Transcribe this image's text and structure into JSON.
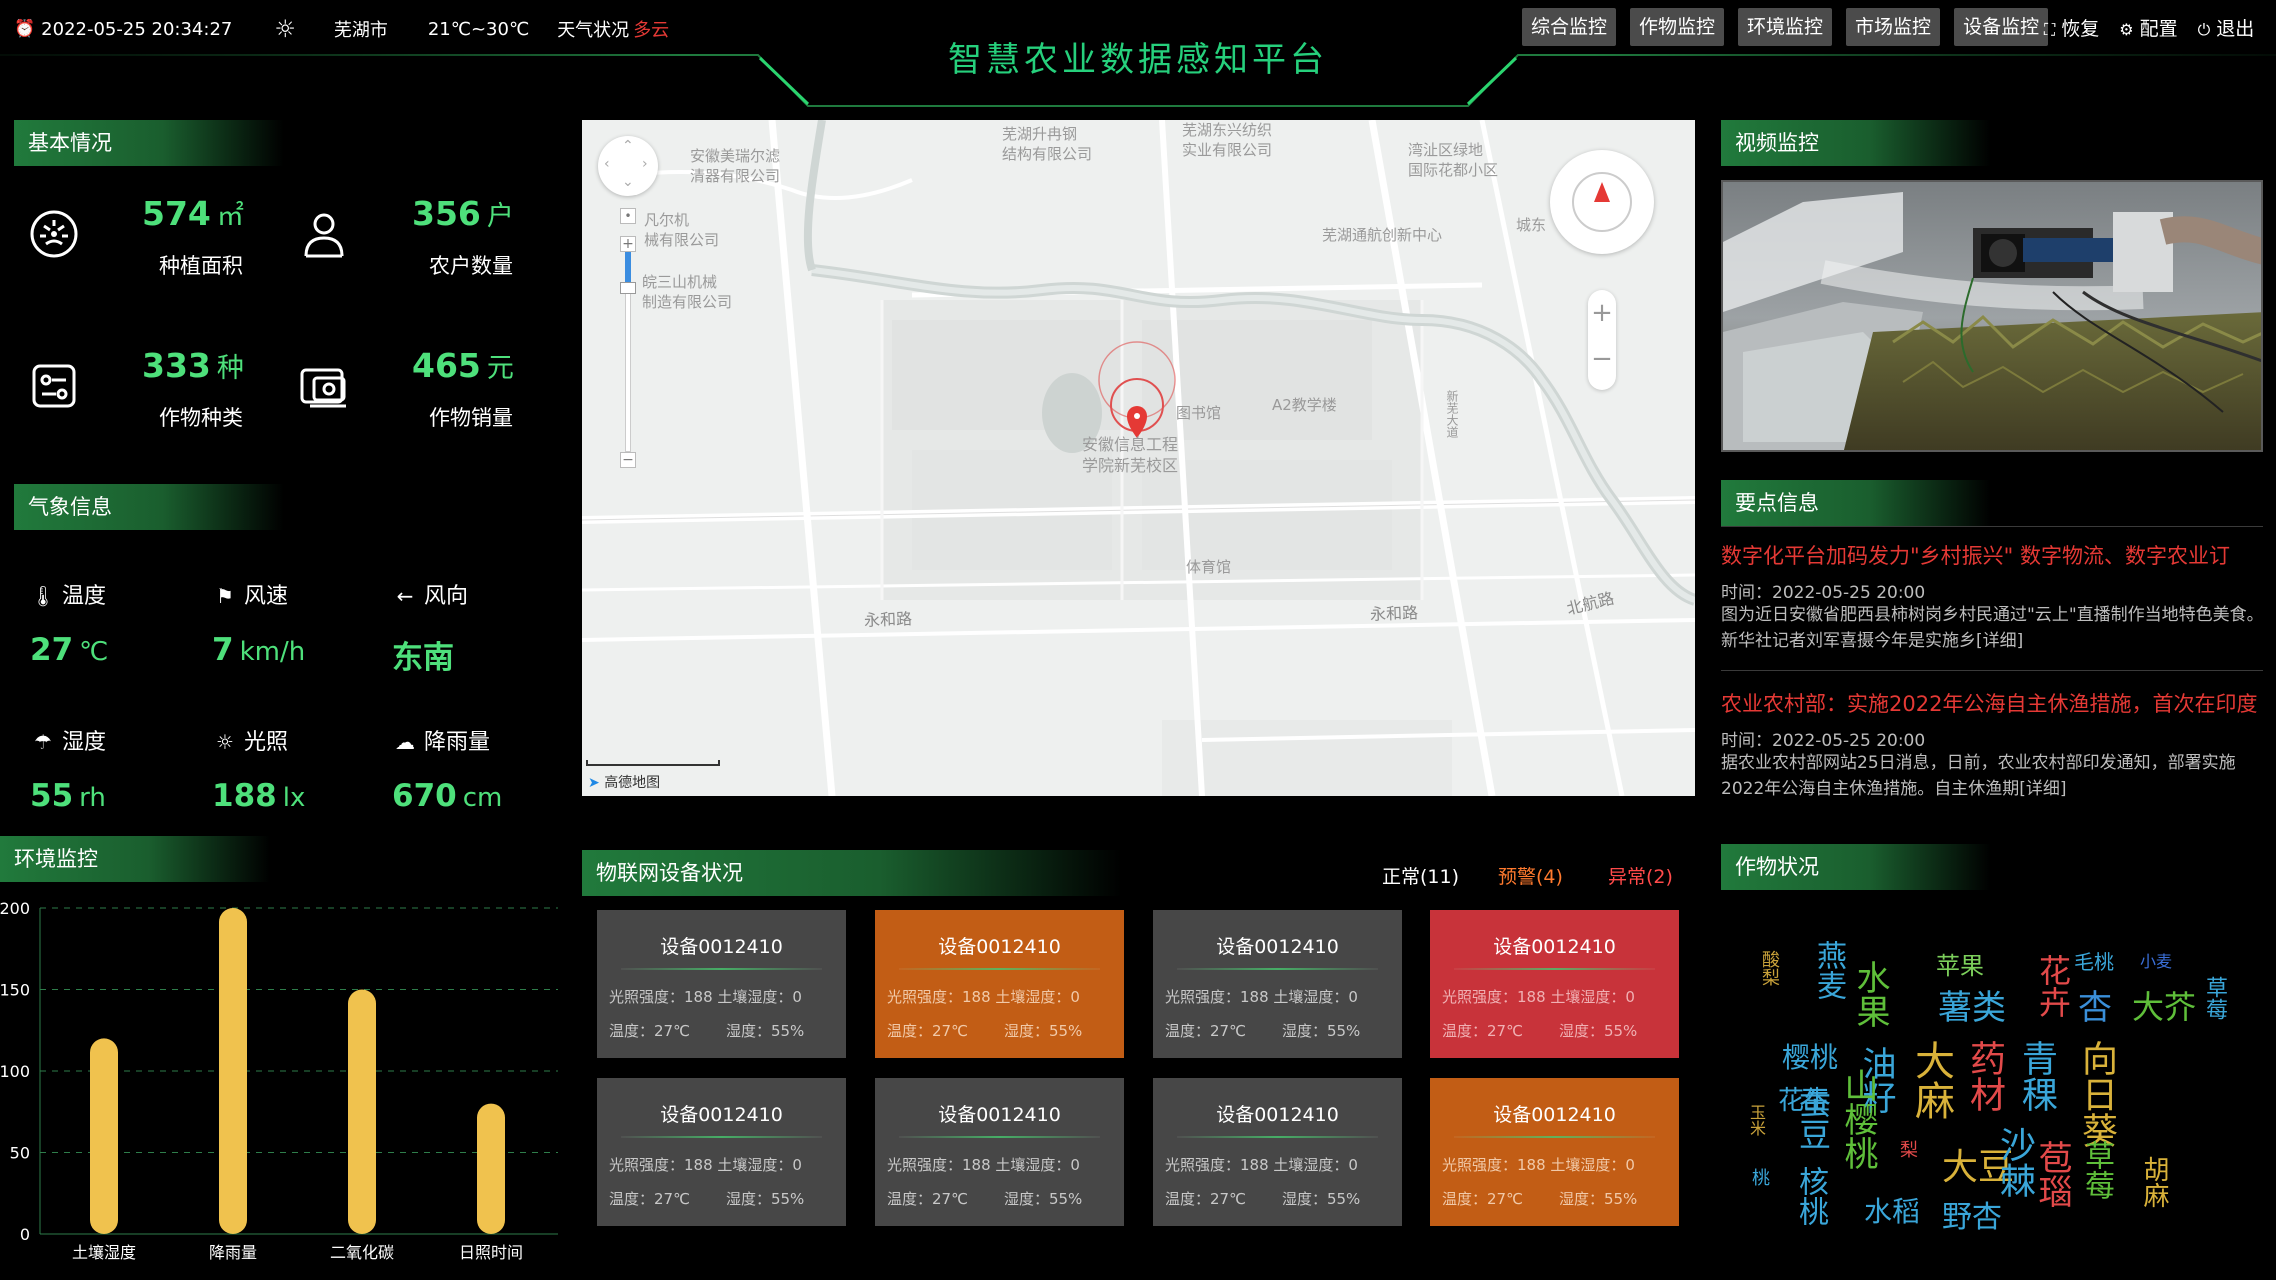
{
  "header": {
    "datetime": "2022-05-25 20:34:27",
    "city": "芜湖市",
    "temperature_range": "21℃~30℃",
    "weather_label": "天气状况",
    "weather_value": "多云",
    "title": "智慧农业数据感知平台",
    "nav": [
      "综合监控",
      "作物监控",
      "环境监控",
      "市场监控",
      "设备监控"
    ],
    "tools": [
      {
        "icon": "expand-icon",
        "label": "恢复"
      },
      {
        "icon": "gear-icon",
        "label": "配置"
      },
      {
        "icon": "power-icon",
        "label": "退出"
      }
    ]
  },
  "basic": {
    "title": "基本情况",
    "items": [
      {
        "icon": "dial-icon",
        "value": "574",
        "unit": "㎡",
        "label": "种植面积"
      },
      {
        "icon": "user-icon",
        "value": "356",
        "unit": "户",
        "label": "农户数量"
      },
      {
        "icon": "settings-panel-icon",
        "value": "333",
        "unit": "种",
        "label": "作物种类"
      },
      {
        "icon": "sales-icon",
        "value": "465",
        "unit": "元",
        "label": "作物销量"
      }
    ]
  },
  "weather": {
    "title": "气象信息",
    "items": [
      {
        "icon": "thermometer-icon",
        "label": "温度",
        "value": "27",
        "unit": "℃"
      },
      {
        "icon": "flag-icon",
        "label": "风速",
        "value": "7",
        "unit": "km/h"
      },
      {
        "icon": "arrow-left-icon",
        "label": "风向",
        "value": "东南",
        "unit": ""
      },
      {
        "icon": "umbrella-icon",
        "label": "湿度",
        "value": "55",
        "unit": "rh"
      },
      {
        "icon": "sun-icon",
        "label": "光照",
        "value": "188",
        "unit": "lx"
      },
      {
        "icon": "cloud-icon",
        "label": "降雨量",
        "value": "670",
        "unit": "cm"
      }
    ]
  },
  "env": {
    "title": "环境监控"
  },
  "chart_data": {
    "type": "bar",
    "categories": [
      "土壤湿度",
      "降雨量",
      "二氧化碳",
      "日照时间"
    ],
    "values": [
      120,
      200,
      150,
      80
    ],
    "ylim": [
      0,
      200
    ],
    "yticks": [
      0,
      50,
      100,
      150,
      200
    ],
    "grid": true,
    "bar_color": "#f0c24e"
  },
  "map": {
    "labels": [
      {
        "text": "安徽美瑞尔滤"
      },
      {
        "text": "清器有限公司"
      },
      {
        "text": "芜湖升冉钢"
      },
      {
        "text": "结构有限公司"
      },
      {
        "text": "芜湖东兴纺织"
      },
      {
        "text": "实业有限公司"
      },
      {
        "text": "湾沚区绿地"
      },
      {
        "text": "国际花都小区"
      },
      {
        "text": "凡尔机"
      },
      {
        "text": "械有限公司"
      },
      {
        "text": "芜湖通航创新中心"
      },
      {
        "text": "城东"
      },
      {
        "text": "皖三山机械"
      },
      {
        "text": "制造有限公司"
      },
      {
        "text": "图书馆"
      },
      {
        "text": "A2教学楼"
      },
      {
        "text": "安徽信息工程"
      },
      {
        "text": "学院新芜校区"
      },
      {
        "text": "体育馆"
      },
      {
        "text": "永和路"
      },
      {
        "text": "永和路"
      },
      {
        "text": "北航路"
      },
      {
        "text": "新芜大道"
      }
    ],
    "attribution": "高德地图"
  },
  "devices": {
    "title": "物联网设备状况",
    "status": {
      "normal": "正常(11)",
      "warn": "预警(4)",
      "error": "异常(2)"
    },
    "colors": {
      "normal": "#474747",
      "warn": "#c25d15",
      "error": "#c8333a",
      "warn_text": "#ff7a2e",
      "error_text": "#ff4a4a"
    },
    "list": [
      {
        "name": "设备0012410",
        "state": "normal",
        "line1": "光照强度：188 土壤湿度：0",
        "temp": "温度：27℃",
        "humidity": "湿度：55%"
      },
      {
        "name": "设备0012410",
        "state": "warn",
        "line1": "光照强度：188 土壤湿度：0",
        "temp": "温度：27℃",
        "humidity": "湿度：55%"
      },
      {
        "name": "设备0012410",
        "state": "normal",
        "line1": "光照强度：188 土壤湿度：0",
        "temp": "温度：27℃",
        "humidity": "湿度：55%"
      },
      {
        "name": "设备0012410",
        "state": "error",
        "line1": "光照强度：188 土壤湿度：0",
        "temp": "温度：27℃",
        "humidity": "湿度：55%"
      },
      {
        "name": "设备0012410",
        "state": "normal",
        "line1": "光照强度：188 土壤湿度：0",
        "temp": "温度：27℃",
        "humidity": "湿度：55%"
      },
      {
        "name": "设备0012410",
        "state": "normal",
        "line1": "光照强度：188 土壤湿度：0",
        "temp": "温度：27℃",
        "humidity": "湿度：55%"
      },
      {
        "name": "设备0012410",
        "state": "normal",
        "line1": "光照强度：188 土壤湿度：0",
        "temp": "温度：27℃",
        "humidity": "湿度：55%"
      },
      {
        "name": "设备0012410",
        "state": "warn",
        "line1": "光照强度：188 土壤湿度：0",
        "temp": "温度：27℃",
        "humidity": "湿度：55%"
      }
    ]
  },
  "video": {
    "title": "视频监控"
  },
  "news": {
    "title": "要点信息",
    "items": [
      {
        "title": "数字化平台加码发力\"乡村振兴\" 数字物流、数字农业订",
        "time": "时间：2022-05-25 20:00",
        "body": "图为近日安徽省肥西县柿树岗乡村民通过\"云上\"直播制作当地特色美食。新华社记者刘军喜摄今年是实施乡[详细]"
      },
      {
        "title": "农业农村部：实施2022年公海自主休渔措施，首次在印度",
        "time": "时间：2022-05-25 20:00",
        "body": "据农业农村部网站25日消息，日前，农业农村部印发通知，部署实施2022年公海自主休渔措施。自主休渔期[详细]"
      }
    ]
  },
  "crops": {
    "title": "作物状况",
    "words": [
      {
        "text": "酸梨",
        "color": "#c9a23a"
      },
      {
        "text": "燕麦",
        "color": "#3aa6d9"
      },
      {
        "text": "水果",
        "color": "#5fbf3a"
      },
      {
        "text": "苹果",
        "color": "#7ccf5b"
      },
      {
        "text": "薯类",
        "color": "#3aa6d9"
      },
      {
        "text": "花卉",
        "color": "#e24a4a"
      },
      {
        "text": "毛桃",
        "color": "#3aa6d9"
      },
      {
        "text": "小麦",
        "color": "#3a6fd9"
      },
      {
        "text": "杏",
        "color": "#3a8fd9"
      },
      {
        "text": "大芥",
        "color": "#5fbf3a"
      },
      {
        "text": "草莓",
        "color": "#3aa6d9"
      },
      {
        "text": "樱桃",
        "color": "#3aa6d9"
      },
      {
        "text": "花生",
        "color": "#3aa6d9"
      },
      {
        "text": "油籽",
        "color": "#3aa6d9"
      },
      {
        "text": "大麻",
        "color": "#d9b23a"
      },
      {
        "text": "药材",
        "color": "#e24a4a"
      },
      {
        "text": "青稞",
        "color": "#3aa6d9"
      },
      {
        "text": "向日葵",
        "color": "#d9b23a"
      },
      {
        "text": "玉米",
        "color": "#c9a23a"
      },
      {
        "text": "蚕豆",
        "color": "#3aa6d9"
      },
      {
        "text": "山樱桃",
        "color": "#5fbf3a"
      },
      {
        "text": "梨",
        "color": "#e24a4a"
      },
      {
        "text": "大豆",
        "color": "#d9b23a"
      },
      {
        "text": "沙棘",
        "color": "#3aa6d9"
      },
      {
        "text": "苞瑙",
        "color": "#e24a4a"
      },
      {
        "text": "草莓",
        "color": "#5fbf3a"
      },
      {
        "text": "胡麻",
        "color": "#d9b23a"
      },
      {
        "text": "桃",
        "color": "#3aa6d9"
      },
      {
        "text": "核桃",
        "color": "#3aa6d9"
      },
      {
        "text": "水稻",
        "color": "#3aa6d9"
      },
      {
        "text": "野杏",
        "color": "#3aa6d9"
      }
    ]
  }
}
